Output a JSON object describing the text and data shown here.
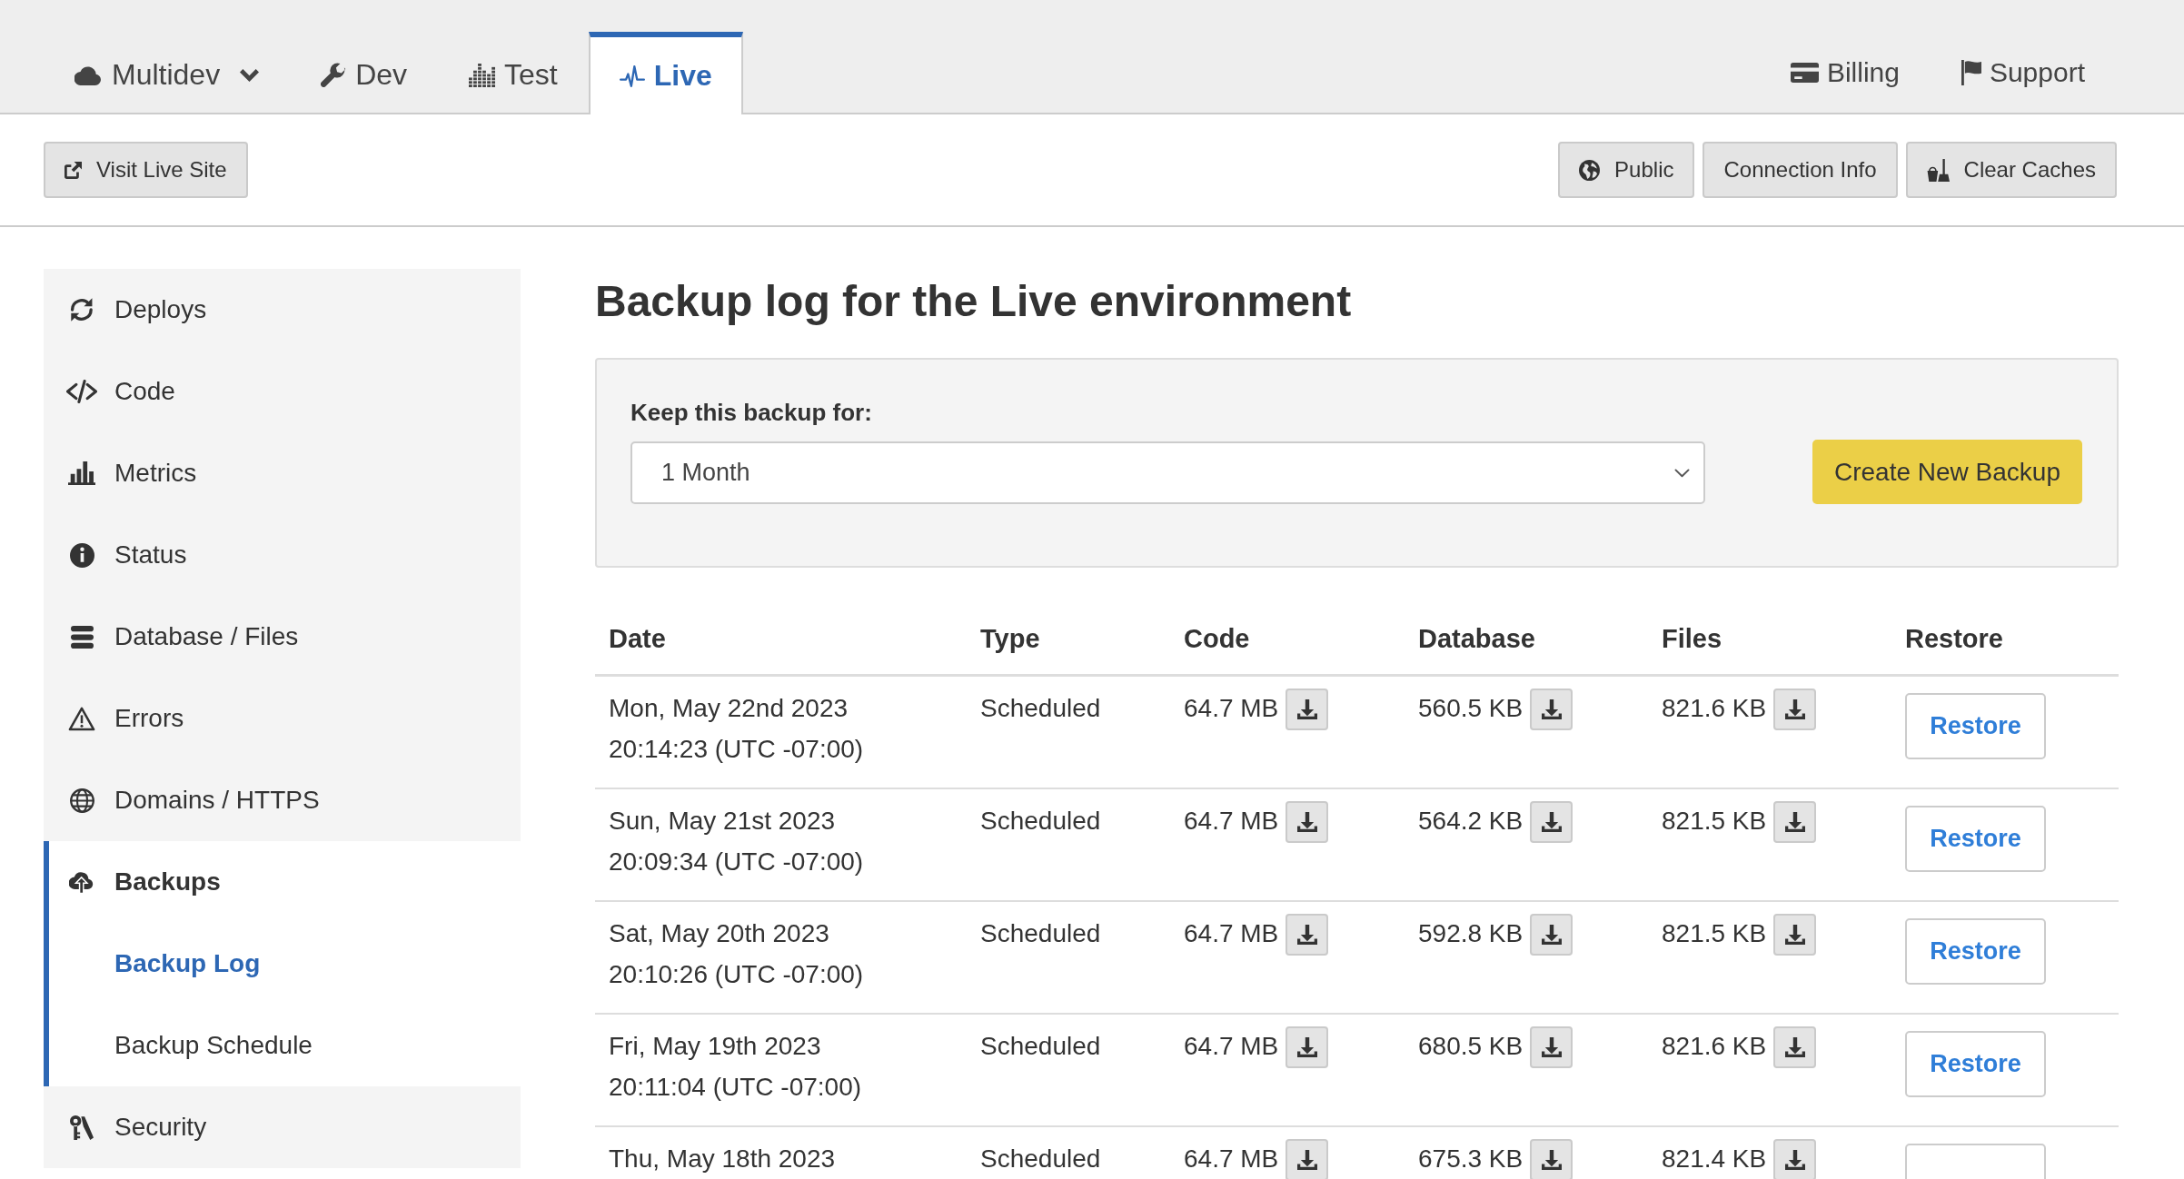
{
  "top_nav": {
    "tabs": [
      {
        "label": "Multidev",
        "kind": "multidev",
        "dropdown": true,
        "selected": false
      },
      {
        "label": "Dev",
        "kind": "dev",
        "dropdown": false,
        "selected": false
      },
      {
        "label": "Test",
        "kind": "test",
        "dropdown": false,
        "selected": false
      },
      {
        "label": "Live",
        "kind": "live",
        "dropdown": false,
        "selected": true
      }
    ],
    "links": [
      {
        "label": "Billing",
        "kind": "billing"
      },
      {
        "label": "Support",
        "kind": "support"
      }
    ]
  },
  "toolbar": {
    "left": [
      {
        "label": "Visit Live Site",
        "kind": "visit"
      }
    ],
    "right": [
      {
        "label": "Public",
        "kind": "public"
      },
      {
        "label": "Connection Info",
        "kind": "connection"
      },
      {
        "label": "Clear Caches",
        "kind": "clear"
      }
    ]
  },
  "sidebar": {
    "items": [
      {
        "label": "Deploys",
        "kind": "deploys",
        "selected": false,
        "expanded": false
      },
      {
        "label": "Code",
        "kind": "code",
        "selected": false,
        "expanded": false
      },
      {
        "label": "Metrics",
        "kind": "metrics",
        "selected": false,
        "expanded": false
      },
      {
        "label": "Status",
        "kind": "status",
        "selected": false,
        "expanded": false
      },
      {
        "label": "Database / Files",
        "kind": "database",
        "selected": false,
        "expanded": false
      },
      {
        "label": "Errors",
        "kind": "errors",
        "selected": false,
        "expanded": false
      },
      {
        "label": "Domains / HTTPS",
        "kind": "domains",
        "selected": false,
        "expanded": false
      },
      {
        "label": "Backups",
        "kind": "backups",
        "selected": false,
        "expanded": true,
        "children": [
          {
            "label": "Backup Log",
            "selected": true
          },
          {
            "label": "Backup Schedule",
            "selected": false
          }
        ]
      },
      {
        "label": "Security",
        "kind": "security",
        "selected": false,
        "expanded": false
      }
    ]
  },
  "main": {
    "title": "Backup log for the Live environment",
    "backup_form": {
      "label": "Keep this backup for:",
      "retention": {
        "value": "1 Month"
      },
      "button": "Create New Backup"
    },
    "table": {
      "columns": [
        "Date",
        "Type",
        "Code",
        "Database",
        "Files",
        "Restore"
      ],
      "rows": [
        {
          "date": "Mon, May 22nd 2023",
          "time": "20:14:23 (UTC -07:00)",
          "type": "Scheduled",
          "code": "64.7 MB",
          "database": "560.5 KB",
          "files": "821.6 KB",
          "restore": "Restore"
        },
        {
          "date": "Sun, May 21st 2023",
          "time": "20:09:34 (UTC -07:00)",
          "type": "Scheduled",
          "code": "64.7 MB",
          "database": "564.2 KB",
          "files": "821.5 KB",
          "restore": "Restore"
        },
        {
          "date": "Sat, May 20th 2023",
          "time": "20:10:26 (UTC -07:00)",
          "type": "Scheduled",
          "code": "64.7 MB",
          "database": "592.8 KB",
          "files": "821.5 KB",
          "restore": "Restore"
        },
        {
          "date": "Fri, May 19th 2023",
          "time": "20:11:04 (UTC -07:00)",
          "type": "Scheduled",
          "code": "64.7 MB",
          "database": "680.5 KB",
          "files": "821.6 KB",
          "restore": "Restore"
        },
        {
          "date": "Thu, May 18th 2023",
          "type": "Scheduled",
          "code": "64.7 MB",
          "database": "675.3 KB",
          "files": "821.4 KB"
        }
      ]
    }
  }
}
